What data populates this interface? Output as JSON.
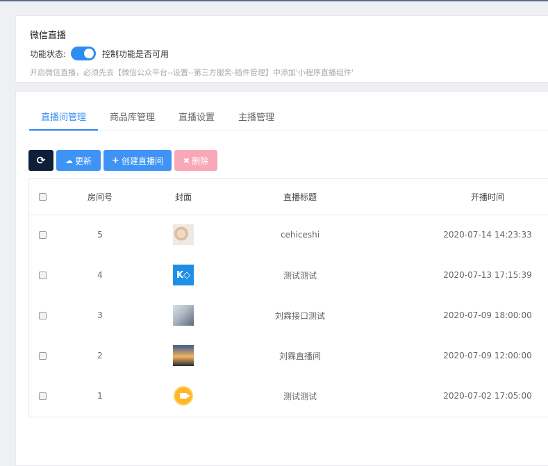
{
  "header": {
    "title": "微信直播",
    "status_label": "功能状态:",
    "toggle_hint": "控制功能是否可用",
    "toggle_on": true,
    "notice": "开启微信直播，必须先去【微信公众平台--设置--第三方服务-插件管理】中添加'小程序直播组件'"
  },
  "tabs": [
    {
      "label": "直播间管理",
      "active": true
    },
    {
      "label": "商品库管理",
      "active": false
    },
    {
      "label": "直播设置",
      "active": false
    },
    {
      "label": "主播管理",
      "active": false
    }
  ],
  "toolbar": {
    "refresh_icon": "⟳",
    "update_label": "更新",
    "create_label": "创建直播间",
    "delete_label": "删除"
  },
  "table": {
    "columns": [
      "房间号",
      "封面",
      "直播标题",
      "开播时间"
    ],
    "rows": [
      {
        "id": "5",
        "cover": "food-thumbnail",
        "title": "cehiceshi",
        "time": "2020-07-14 14:23:33"
      },
      {
        "id": "4",
        "cover": "logo-thumbnail",
        "title": "测试测试",
        "time": "2020-07-13 17:15:39"
      },
      {
        "id": "3",
        "cover": "desk-thumbnail",
        "title": "刘霖接口测试",
        "time": "2020-07-09 18:00:00"
      },
      {
        "id": "2",
        "cover": "sunset-thumbnail",
        "title": "刘霖直播间",
        "time": "2020-07-09 12:00:00"
      },
      {
        "id": "1",
        "cover": "camera-thumbnail",
        "title": "测试测试",
        "time": "2020-07-02 17:05:00"
      }
    ]
  },
  "colors": {
    "accent": "#2e8df0",
    "refresh_button": "#0f1f3a",
    "delete_button": "#f8a8b8"
  }
}
